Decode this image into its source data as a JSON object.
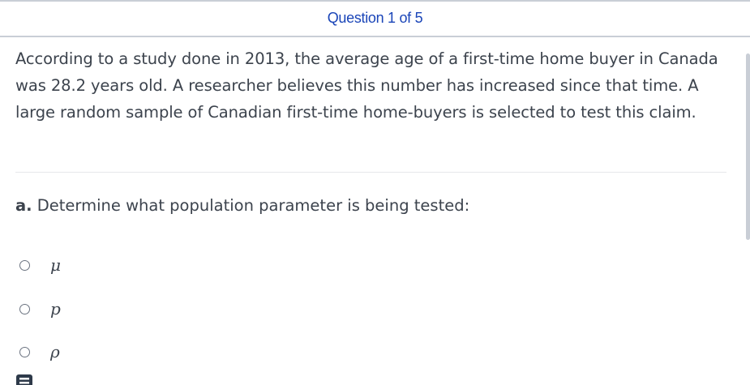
{
  "header": {
    "title": "Question 1 of 5"
  },
  "question": {
    "text": "According to a study done in 2013, the average age of a first-time home buyer in Canada was 28.2 years old. A researcher believes this number has increased since that time. A large random sample of Canadian first-time home-buyers is selected to test this claim."
  },
  "part_a": {
    "label": "a.",
    "prompt": " Determine what population parameter is being tested:",
    "options": [
      {
        "label": "μ",
        "selected": false
      },
      {
        "label": "p",
        "selected": false
      },
      {
        "label": "ρ",
        "selected": false
      }
    ]
  },
  "icons": {
    "calculator": "calculator-icon"
  },
  "colors": {
    "header_text": "#1a45b8",
    "body_text": "#3c434d",
    "border": "#c9ced6"
  }
}
